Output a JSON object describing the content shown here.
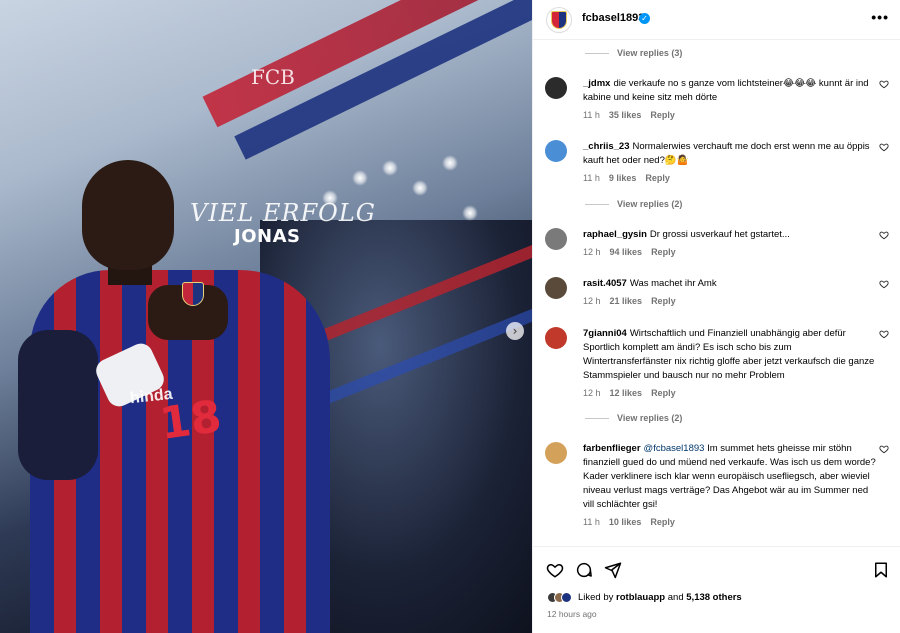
{
  "media": {
    "overlay_line1": "VIEL ERFOLG",
    "overlay_line2": "JONAS",
    "logo_text": "FCB",
    "jersey_number": "18",
    "sponsor_text": "hinda"
  },
  "header": {
    "username": "fcbasel1893",
    "verified": true,
    "more_icon": "more-horizontal-icon"
  },
  "comments": [
    {
      "user": "_jdmx",
      "text": "die verkaufe no s ganze vom lichtsteiner😂😂😂 kunnt är ind kabine und keine sitz meh dörte",
      "time": "11 h",
      "likes": "35 likes",
      "reply": "Reply",
      "avatar_color": "#2b2b2b"
    },
    {
      "user": "_chriis_23",
      "text": "Normalerwies verchauft me doch erst wenn me au öppis kauft het oder ned?🤔🤷",
      "time": "11 h",
      "likes": "9 likes",
      "reply": "Reply",
      "avatar_color": "#4a8fd6"
    },
    {
      "user": "raphael_gysin",
      "text": "Dr grossi usverkauf het gstartet...",
      "time": "12 h",
      "likes": "94 likes",
      "reply": "Reply",
      "avatar_color": "#7a7a7a"
    },
    {
      "user": "rasit.4057",
      "text": "Was machet ihr Amk",
      "time": "12 h",
      "likes": "21 likes",
      "reply": "Reply",
      "avatar_color": "#5a4a3a"
    },
    {
      "user": "7gianni04",
      "text": "Wirtschaftlich und Finanziell unabhängig aber defür Sportlich komplett am ändi? Es isch scho bis zum Wintertransferfänster nix richtig gloffe aber jetzt verkaufsch die ganze Stammspieler und bausch nur no mehr Problem",
      "time": "12 h",
      "likes": "12 likes",
      "reply": "Reply",
      "avatar_color": "#c0392b"
    },
    {
      "user": "farbenflieger",
      "mention": "@fcbasel1893",
      "text": "Im summet hets gheisse mir stöhn finanziell gued do und müend ned verkaufe. Was isch us dem worde? Kader verklinere isch klar wenn europäisch usefliegsch, aber wieviel niveau verlust mags verträge? Das Ahgebot wär au im Summer ned vill schlächter gsi!",
      "time": "11 h",
      "likes": "10 likes",
      "reply": "Reply",
      "avatar_color": "#d4a15a"
    }
  ],
  "view_replies": [
    "View replies (3)",
    "View replies (2)",
    "View replies (2)"
  ],
  "actions": {
    "like_icon": "heart-icon",
    "comment_icon": "comment-icon",
    "share_icon": "share-icon",
    "save_icon": "bookmark-icon",
    "liked_by_prefix": "Liked by",
    "liked_by_user": "rotblauapp",
    "liked_by_and": "and",
    "liked_by_others": "5,138 others",
    "time_ago": "12 hours ago"
  }
}
